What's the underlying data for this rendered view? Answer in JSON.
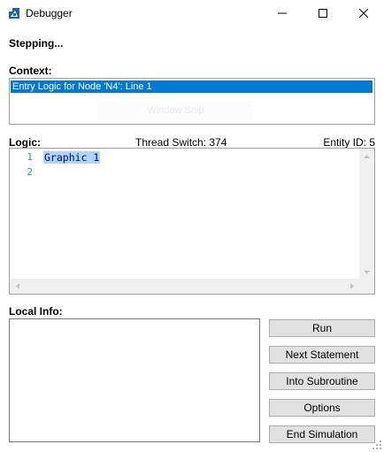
{
  "window": {
    "title": "Debugger",
    "icon": "debugger-app-icon",
    "controls": [
      "minimize-icon",
      "maximize-icon",
      "close-icon"
    ]
  },
  "status_text": "Stepping...",
  "context": {
    "label": "Context:",
    "selected_item": "Entry Logic for Node 'N4': Line 1",
    "faint_overlay_text": "Window Snip"
  },
  "logic": {
    "label": "Logic:",
    "thread_switch": "Thread Switch: 374",
    "entity_id": "Entity ID: 5",
    "line_numbers": [
      "1",
      "2"
    ],
    "lines": [
      "Graphic 1",
      ""
    ]
  },
  "local_info": {
    "label": "Local Info:"
  },
  "buttons": {
    "run": "Run",
    "next_statement": "Next Statement",
    "into_subroutine": "Into Subroutine",
    "options": "Options",
    "end_simulation": "End Simulation"
  },
  "colors": {
    "selection": "#0078d7",
    "code_highlight": "#add6ff",
    "line_number": "#2b91af",
    "button_face": "#e1e1e1"
  }
}
